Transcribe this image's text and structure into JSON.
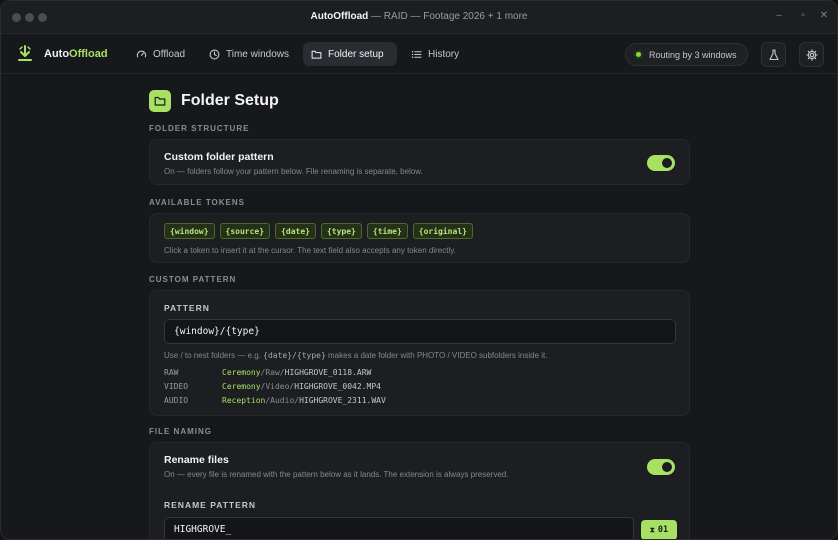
{
  "window": {
    "title_app": "AutoOffload",
    "title_rest": " — RAID — Footage 2026 + 1 more"
  },
  "nav": {
    "logo_prefix": "Auto",
    "logo_suffix": "Offload",
    "tabs": [
      {
        "label": "Offload",
        "icon": "gauge-icon"
      },
      {
        "label": "Time windows",
        "icon": "clock-icon"
      },
      {
        "label": "Folder setup",
        "icon": "folder-icon",
        "active": true
      },
      {
        "label": "History",
        "icon": "list-icon"
      }
    ],
    "routing_status": "Routing by 3 windows"
  },
  "page": {
    "title": "Folder Setup"
  },
  "folder_structure": {
    "section_label": "FOLDER STRUCTURE",
    "title": "Custom folder pattern",
    "description": "On — folders follow your pattern below. File renaming is separate, below.",
    "enabled": true
  },
  "available_tokens": {
    "section_label": "AVAILABLE TOKENS",
    "tokens": [
      "{window}",
      "{source}",
      "{date}",
      "{type}",
      "{time}",
      "{original}"
    ],
    "hint": "Click a token to insert it at the cursor. The text field also accepts any token directly."
  },
  "custom_pattern": {
    "section_label": "CUSTOM PATTERN",
    "field_label": "PATTERN",
    "value": "{window}/{type}",
    "hint_prefix": "Use / to nest folders — e.g. ",
    "hint_code": "{date}/{type}",
    "hint_suffix": " makes a date folder with PHOTO / VIDEO subfolders inside it.",
    "examples": [
      {
        "kind": "RAW",
        "window": "Ceremony",
        "type": "/Raw/",
        "file": "HIGHGROVE_0118.ARW"
      },
      {
        "kind": "VIDEO",
        "window": "Ceremony",
        "type": "/Video/",
        "file": "HIGHGROVE_0042.MP4"
      },
      {
        "kind": "AUDIO",
        "window": "Reception",
        "type": "/Audio/",
        "file": "HIGHGROVE_2311.WAV"
      }
    ]
  },
  "file_naming": {
    "section_label": "FILE NAMING",
    "title": "Rename files",
    "description": "On — every file is renamed with the pattern below as it lands. The extension is always preserved.",
    "enabled": true,
    "field_label": "RENAME PATTERN",
    "value": "HIGHGROVE_",
    "counter": "01"
  },
  "colors": {
    "accent": "#a8e063",
    "background": "#16181c",
    "card": "#1c1e22"
  }
}
